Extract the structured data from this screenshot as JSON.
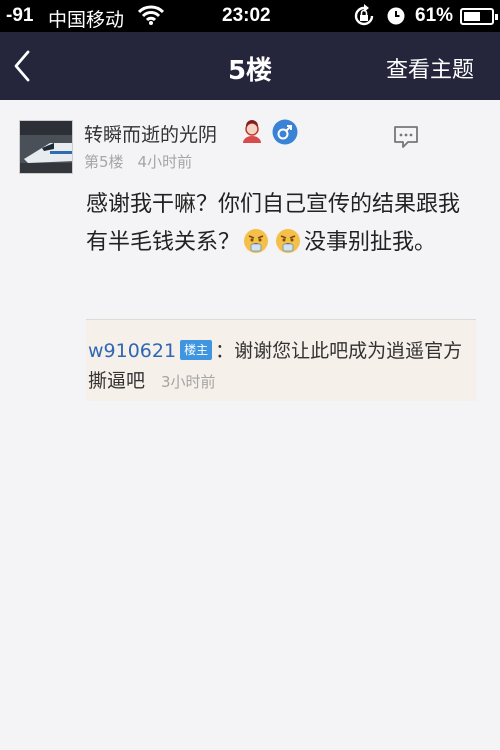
{
  "status_bar": {
    "signal": "-91",
    "carrier": "中国移动",
    "time": "23:02",
    "battery": "61%",
    "icons": [
      "wifi-icon",
      "rotation-lock-icon",
      "alarm-clock-icon",
      "battery-icon"
    ]
  },
  "nav": {
    "title": "5楼",
    "action_label": "查看主题",
    "back_icon": "chevron-left-icon"
  },
  "post": {
    "username": "转瞬而逝的光阴",
    "floor": "第5楼",
    "time": "4小时前",
    "content": {
      "part1": "感谢我干嘛？你们自己宣传的结果跟我有半毛钱关系？",
      "part2": "没事别扯我。"
    },
    "emoji": "angry-emoji"
  },
  "reply": {
    "user": "w910621",
    "badge": "楼主",
    "text": "：谢谢您让此吧成为逍遥官方撕逼吧",
    "time": "3小时前"
  },
  "colors": {
    "nav_bg": "#25253c",
    "page_bg": "#f4f4f6",
    "reply_bg": "#f6f0ea",
    "link": "#2f67b5",
    "badge": "#3f95e0"
  }
}
